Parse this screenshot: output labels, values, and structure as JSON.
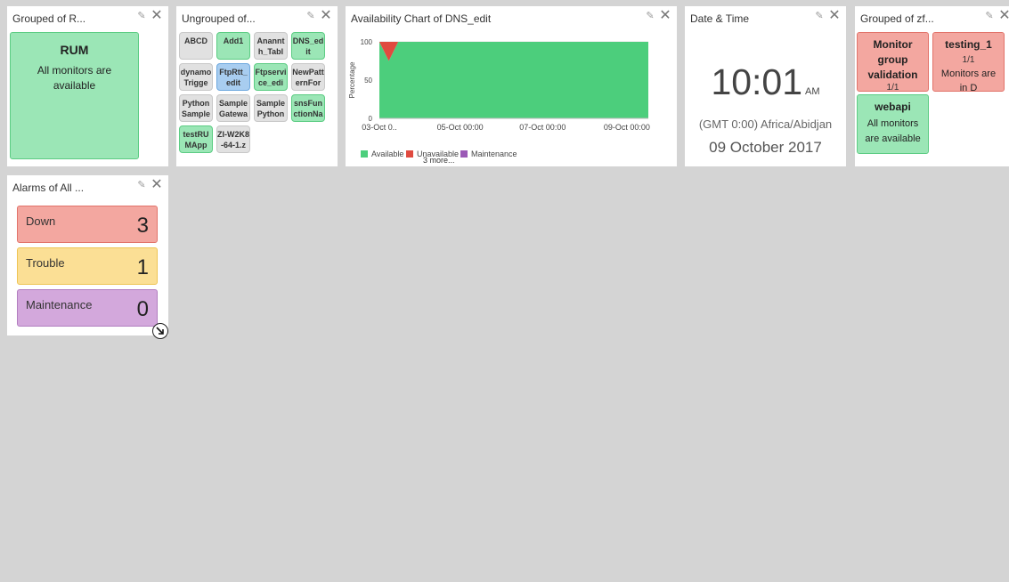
{
  "widgets": {
    "grouped_rum": {
      "title": "Grouped of R...",
      "card": {
        "name": "RUM",
        "status": "All monitors are available"
      }
    },
    "ungrouped": {
      "title": "Ungrouped of...",
      "tiles": [
        {
          "label": "ABCD",
          "status": "grey"
        },
        {
          "label": "Add1",
          "status": "green"
        },
        {
          "label": "Anannth_Tabl",
          "status": "grey"
        },
        {
          "label": "DNS_edit",
          "status": "green"
        },
        {
          "label": "dynamoTrigge",
          "status": "grey"
        },
        {
          "label": "FtpRtt_edit",
          "status": "blue"
        },
        {
          "label": "Ftpservice_edi",
          "status": "green"
        },
        {
          "label": "NewPatternFor",
          "status": "grey"
        },
        {
          "label": "PythonSample",
          "status": "grey"
        },
        {
          "label": "SampleGatewa",
          "status": "grey"
        },
        {
          "label": "SamplePython",
          "status": "grey"
        },
        {
          "label": "snsFunctionNa",
          "status": "green"
        },
        {
          "label": "testRUMApp",
          "status": "green"
        },
        {
          "label": "ZI-W2K8-64-1.z",
          "status": "grey"
        }
      ]
    },
    "availability": {
      "title": "Availability Chart of DNS_edit",
      "more": "3 more..."
    },
    "datetime": {
      "title": "Date & Time",
      "time": "10:01",
      "ampm": "AM",
      "timezone": "(GMT 0:00) Africa/Abidjan",
      "date": "09 October 2017"
    },
    "grouped_zf": {
      "title": "Grouped of zf...",
      "cards": [
        {
          "name": "Monitor group validation",
          "count": "1/1",
          "status": "red"
        },
        {
          "name": "testing_1",
          "count": "1/1",
          "detail": "Monitors are in D",
          "status": "red"
        },
        {
          "name": "webapi",
          "detail": "All monitors are available",
          "status": "green"
        }
      ]
    },
    "alarms": {
      "title": "Alarms of All ...",
      "items": [
        {
          "label": "Down",
          "count": "3"
        },
        {
          "label": "Trouble",
          "count": "1"
        },
        {
          "label": "Maintenance",
          "count": "0"
        }
      ]
    }
  },
  "icons": {
    "edit": "pencil-icon",
    "close": "close-icon",
    "resize": "resize-handle-icon"
  },
  "colors": {
    "available": "#4cce7c",
    "unavailable": "#e04a3f",
    "maintenance": "#9b59b6",
    "down_bg": "#f3a7a0",
    "trouble_bg": "#fbdf95",
    "maintenance_bg": "#d3a8dc"
  },
  "chart_data": {
    "type": "area",
    "title": "",
    "xlabel": "",
    "ylabel": "Percentage",
    "x_ticks": [
      "03-Oct 0..",
      "05-Oct 00:00",
      "07-Oct 00:00",
      "09-Oct 00:00"
    ],
    "y_ticks": [
      0,
      50,
      100
    ],
    "ylim": [
      0,
      100
    ],
    "series": [
      {
        "name": "Available",
        "color": "#4cce7c",
        "values": [
          100,
          75,
          100,
          100,
          100,
          100,
          100
        ]
      },
      {
        "name": "Unavailable",
        "color": "#e04a3f",
        "values": [
          0,
          25,
          0,
          0,
          0,
          0,
          0
        ]
      },
      {
        "name": "Maintenance",
        "color": "#9b59b6",
        "values": [
          0,
          0,
          0,
          0,
          0,
          0,
          0
        ]
      }
    ],
    "legend": "bottom-left"
  }
}
